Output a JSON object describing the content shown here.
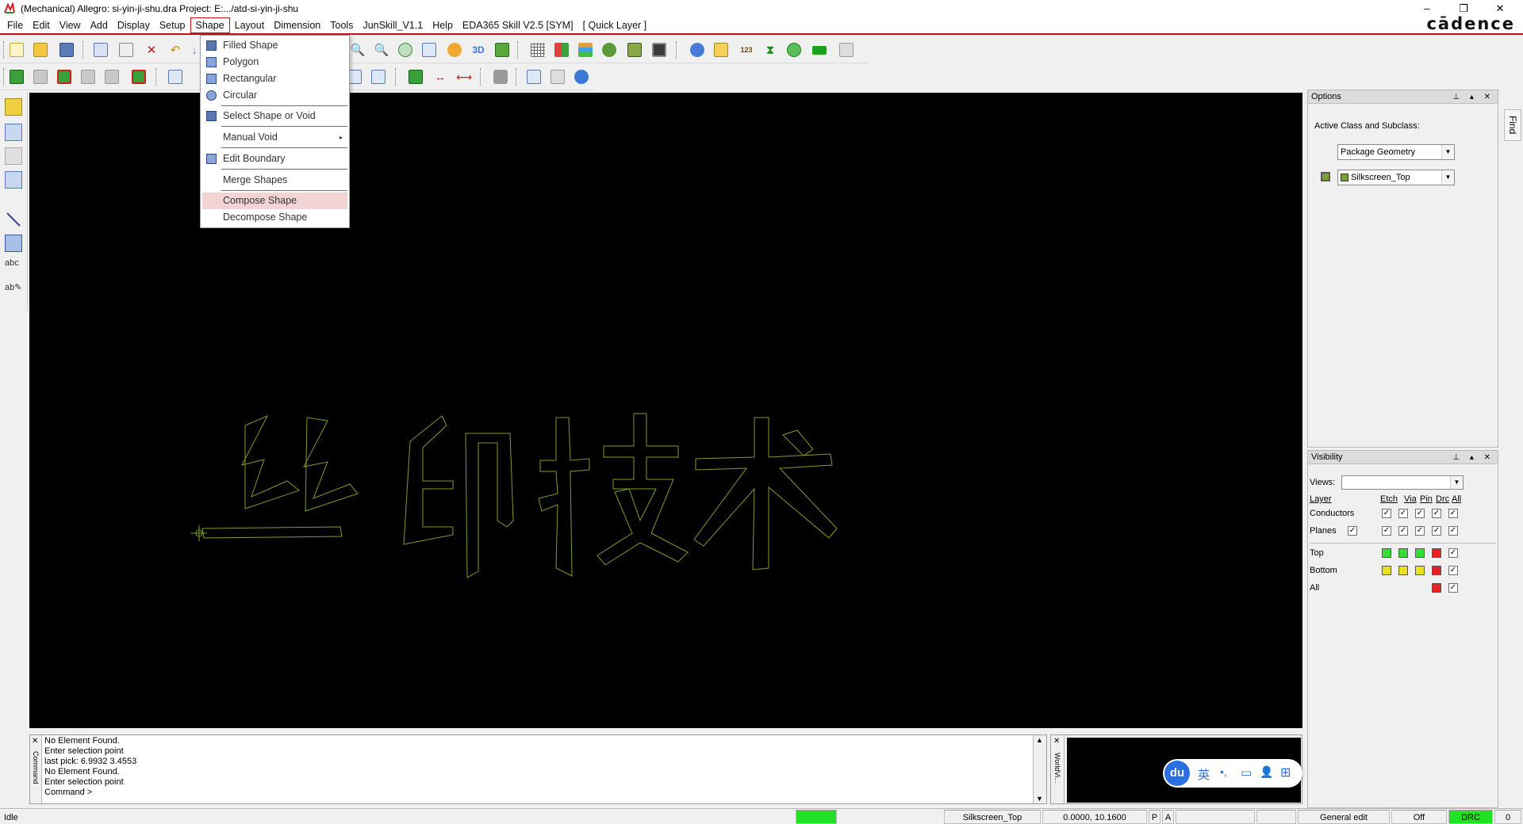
{
  "window": {
    "title": "(Mechanical) Allegro: si-yin-ji-shu.dra  Project: E:.../atd-si-yin-ji-shu",
    "minimize": "–",
    "restore": "❐",
    "close": "✕"
  },
  "brand": {
    "logo_text": "cādence"
  },
  "menubar": {
    "items": [
      "File",
      "Edit",
      "View",
      "Add",
      "Display",
      "Setup",
      "Shape",
      "Layout",
      "Dimension",
      "Tools",
      "JunSkill_V1.1",
      "Help",
      "EDA365 Skill V2.5 [SYM]",
      "[ Quick Layer ]"
    ],
    "active": "Shape"
  },
  "shape_menu": {
    "items": [
      {
        "label": "Filled Shape",
        "icon": "filled-shape-icon"
      },
      {
        "label": "Polygon",
        "icon": "polygon-icon"
      },
      {
        "label": "Rectangular",
        "icon": "rectangle-icon"
      },
      {
        "label": "Circular",
        "icon": "circle-icon"
      },
      {
        "label": "Select Shape or Void",
        "icon": "select-shape-icon"
      },
      {
        "label": "Manual Void",
        "icon": "",
        "submenu": "▸"
      },
      {
        "label": "Edit Boundary",
        "icon": "edit-boundary-icon"
      },
      {
        "label": "Merge Shapes",
        "icon": ""
      },
      {
        "label": "Compose Shape",
        "icon": "",
        "highlighted": true
      },
      {
        "label": "Decompose Shape",
        "icon": ""
      }
    ]
  },
  "canvas": {
    "background": "#000000",
    "silkscreen_text": "丝印技术",
    "outline_color": "#7f9a2a"
  },
  "options_panel": {
    "title": "Options",
    "controls": "⊥ ▴ ✕",
    "active_label": "Active Class and Subclass:",
    "class_value": "Package Geometry",
    "subclass_value": "Silkscreen_Top",
    "subclass_color": "#7aa12a"
  },
  "find_tab": {
    "label": "Find"
  },
  "visibility_panel": {
    "title": "Visibility",
    "controls": "⊥ ▴ ✕",
    "views_label": "Views:",
    "views_value": "",
    "headers": [
      "Layer",
      "Etch",
      "Via",
      "Pin",
      "Drc",
      "All"
    ],
    "rows": [
      {
        "name": "Conductors"
      },
      {
        "name": "Planes"
      },
      {
        "name": "Top",
        "colors": [
          "#33e033",
          "#33e033",
          "#33e033",
          "#e82020"
        ]
      },
      {
        "name": "Bottom",
        "colors": [
          "#e8e020",
          "#e8e020",
          "#e8e020",
          "#e82020"
        ]
      },
      {
        "name": "All",
        "colors": [
          "#e82020"
        ]
      }
    ]
  },
  "command": {
    "side_label": "Command",
    "lines": [
      "No Element Found.",
      "Enter selection point",
      "last pick:  6.9932 3.4553",
      "No Element Found.",
      "Enter selection point",
      "Command >"
    ]
  },
  "worldview": {
    "side_label": "WorldVi..."
  },
  "ime": {
    "logo": "du",
    "lang": "英",
    "punct": "•,",
    "icons": [
      "▭",
      "👤",
      "⊞"
    ]
  },
  "status": {
    "state": "Idle",
    "indicator_color": "#22e022",
    "subclass": "Silkscreen_Top",
    "coords": "0.0000, 10.1600",
    "p_flag": "P",
    "a_flag": "A",
    "mode": "General edit",
    "off": "Off",
    "drc": "DRC",
    "drc_count": "0"
  }
}
